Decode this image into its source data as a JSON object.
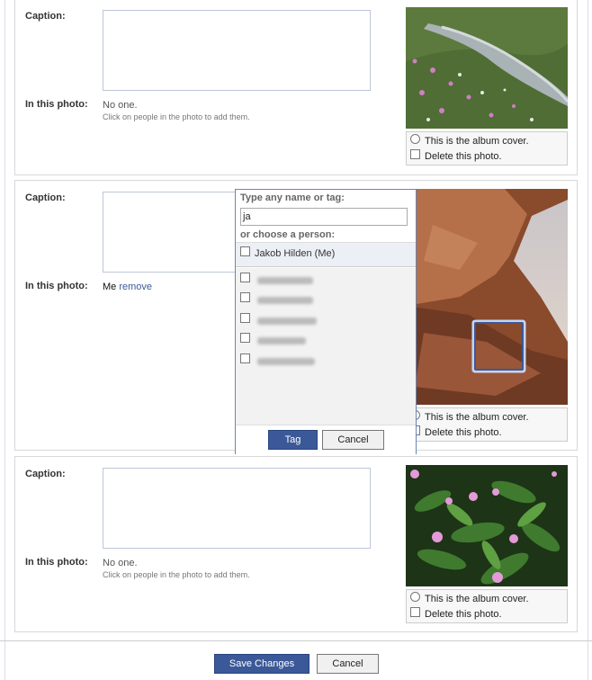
{
  "labels": {
    "caption": "Caption:",
    "in_this_photo": "In this photo:",
    "no_one": "No one.",
    "hint": "Click on people in the photo to add them.",
    "me": "Me",
    "remove": "remove",
    "album_cover": "This is the album cover.",
    "delete_photo": "Delete this photo."
  },
  "photos": [
    {
      "subject": "mountain stream meadow with wildflowers",
      "colors": [
        "#5d7a3e",
        "#8aa05a",
        "#b0b8b8"
      ]
    },
    {
      "subject": "red rock butte desert at sunset",
      "colors": [
        "#9a5a38",
        "#c7895c",
        "#d8d0c8"
      ]
    },
    {
      "subject": "pink wildflowers with green leaves",
      "colors": [
        "#1f3a17",
        "#3f7a2e",
        "#e09ad0"
      ]
    }
  ],
  "tag_popup": {
    "heading": "Type any name or tag:",
    "input_value": "ja",
    "choose_label": "or choose a person:",
    "self_entry": "Jakob Hilden (Me)",
    "tag_button": "Tag",
    "cancel_button": "Cancel"
  },
  "footer": {
    "save_button": "Save Changes",
    "cancel_button": "Cancel"
  },
  "colors": {
    "brand": "#3b5998",
    "border": "#d8d8d8"
  }
}
